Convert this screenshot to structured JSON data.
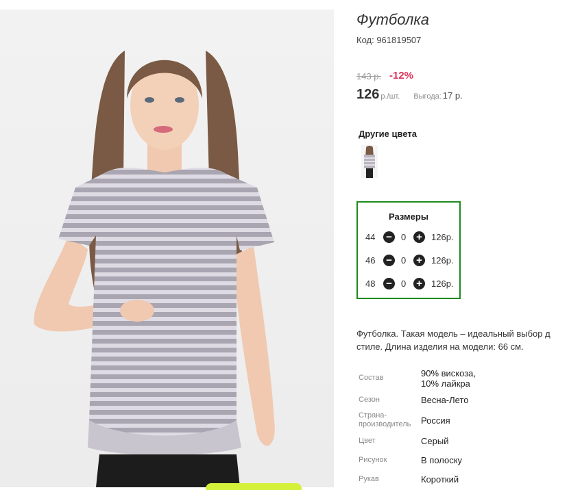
{
  "product": {
    "title": "Футболка",
    "code": "Код: 961819507",
    "old_price": "143 р.",
    "discount": "-12%",
    "price": "126",
    "price_unit": "р./шт.",
    "savings_label": "Выгода:",
    "savings_value": "17 р."
  },
  "other_colors": {
    "title": "Другие цвета"
  },
  "sizes": {
    "title": "Размеры",
    "rows": [
      {
        "size": "44",
        "qty": "0",
        "price": "126р."
      },
      {
        "size": "46",
        "qty": "0",
        "price": "126р."
      },
      {
        "size": "48",
        "qty": "0",
        "price": "126р."
      }
    ],
    "minus_icon": "minus-icon",
    "plus_icon": "plus-icon"
  },
  "description": {
    "line1": "Футболка. Такая модель – идеальный выбор д",
    "line2": "стиле. Длина изделия на модели: 66 см."
  },
  "attributes": [
    {
      "label": "Состав",
      "value_line1": "90% вискоза,",
      "value_line2": "10% лайкра"
    },
    {
      "label": "Сезон",
      "value_line1": "Весна-Лето"
    },
    {
      "label_line1": "Страна-",
      "label_line2": "производитель",
      "value_line1": "Россия"
    },
    {
      "label": "Цвет",
      "value_line1": "Серый"
    },
    {
      "label": "Рисунок",
      "value_line1": "В полоску"
    },
    {
      "label": "Рукав",
      "value_line1": "Короткий"
    }
  ],
  "colors": {
    "discount": "#e0335a",
    "sizes_border": "#1e8a1e",
    "stripe_gray": "#a8a4b0",
    "stripe_light": "#dcd9e2"
  }
}
